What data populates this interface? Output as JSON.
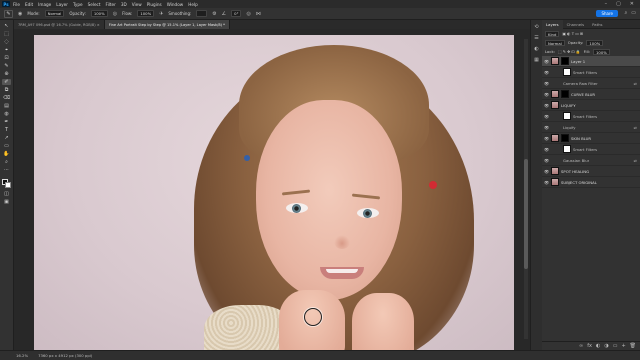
{
  "app": {
    "logo": "Ps"
  },
  "menu": [
    "File",
    "Edit",
    "Image",
    "Layer",
    "Type",
    "Select",
    "Filter",
    "3D",
    "View",
    "Plugins",
    "Window",
    "Help"
  ],
  "window_controls": [
    "–",
    "▢",
    "✕"
  ],
  "options": {
    "mode_label": "Mode:",
    "mode_value": "Normal",
    "opacity_label": "Opacity:",
    "opacity_value": "100%",
    "flow_label": "Flow:",
    "flow_value": "100%",
    "smoothing_label": "Smoothing:",
    "angle_value": "0°",
    "share_label": "Share"
  },
  "tabs": [
    {
      "label": "7RM_A97 096.psd @ 16.7% (Guide, RGB/8) ×",
      "active": false
    },
    {
      "label": "Fine Art Portrait Step by Step @ 15.1% (Layer 1, Layer Mask/8) *",
      "active": true
    }
  ],
  "tools": [
    "↖",
    "⬚",
    "◌",
    "⌖",
    "⊡",
    "✎",
    "⊕",
    "✐",
    "⧉",
    "⌫",
    "▤",
    "◍",
    "✒",
    "T",
    "↗",
    "▭",
    "✋",
    "⌕",
    "⋯"
  ],
  "status": {
    "zoom": "16.2%",
    "doc": "7360 px x 4912 px (300 ppi)"
  },
  "layers_panel": {
    "tabs": [
      {
        "label": "Layers",
        "active": true
      },
      {
        "label": "Channels",
        "active": false
      },
      {
        "label": "Paths",
        "active": false
      }
    ],
    "kind_label": "Kind",
    "blend_mode": "Normal",
    "opacity_label": "Opacity:",
    "opacity_value": "100%",
    "lock_label": "Lock:",
    "fill_label": "Fill:",
    "fill_value": "100%",
    "layers": [
      {
        "name": "Layer 1",
        "thumb": "photo-t",
        "mask": true,
        "selected": true,
        "indent": false,
        "fx": ""
      },
      {
        "name": "Smart Filters",
        "thumb": "white",
        "mask": false,
        "selected": false,
        "indent": true,
        "fx": ""
      },
      {
        "name": "Camera Raw Filter",
        "thumb": "",
        "mask": false,
        "selected": false,
        "indent": true,
        "fx": "⇌"
      },
      {
        "name": "CURVE BLUR",
        "thumb": "photo-t",
        "mask": true,
        "selected": false,
        "indent": false,
        "fx": ""
      },
      {
        "name": "LIQUIFY",
        "thumb": "photo-t",
        "mask": false,
        "selected": false,
        "indent": false,
        "fx": ""
      },
      {
        "name": "Smart Filters",
        "thumb": "white",
        "mask": false,
        "selected": false,
        "indent": true,
        "fx": ""
      },
      {
        "name": "Liquify",
        "thumb": "",
        "mask": false,
        "selected": false,
        "indent": true,
        "fx": "⇌"
      },
      {
        "name": "SKIN BLUR",
        "thumb": "photo-t",
        "mask": true,
        "selected": false,
        "indent": false,
        "fx": ""
      },
      {
        "name": "Smart Filters",
        "thumb": "white",
        "mask": false,
        "selected": false,
        "indent": true,
        "fx": ""
      },
      {
        "name": "Gaussian Blur",
        "thumb": "",
        "mask": false,
        "selected": false,
        "indent": true,
        "fx": "⇌"
      },
      {
        "name": "SPOT HEALING",
        "thumb": "photo-t",
        "mask": false,
        "selected": false,
        "indent": false,
        "fx": ""
      },
      {
        "name": "SUBJECT ORIGINAL",
        "thumb": "photo-t",
        "mask": false,
        "selected": false,
        "indent": false,
        "fx": ""
      }
    ],
    "footer_icons": [
      "∞",
      "fx",
      "◐",
      "◑",
      "▭",
      "+",
      "🗑"
    ]
  }
}
